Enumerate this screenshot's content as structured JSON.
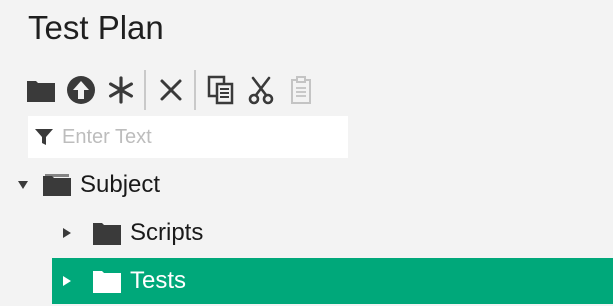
{
  "page": {
    "title": "Test Plan"
  },
  "toolbar": {
    "buttons": [
      {
        "name": "new-folder",
        "icon": "folder-icon"
      },
      {
        "name": "upload",
        "icon": "upload-arrow-icon"
      },
      {
        "name": "new-test",
        "icon": "asterisk-icon"
      },
      {
        "name": "delete",
        "icon": "close-icon"
      },
      {
        "name": "copy",
        "icon": "copy-icon"
      },
      {
        "name": "cut",
        "icon": "scissors-icon",
        "disabled": true
      },
      {
        "name": "paste",
        "icon": "clipboard-icon",
        "disabled": true
      }
    ]
  },
  "filter": {
    "placeholder": "Enter Text",
    "value": ""
  },
  "tree": {
    "root": {
      "label": "Subject",
      "expanded": true
    },
    "children": [
      {
        "label": "Scripts",
        "expanded": false,
        "selected": false
      },
      {
        "label": "Tests",
        "expanded": false,
        "selected": true
      }
    ]
  },
  "colors": {
    "selection": "#00a87a",
    "icon": "#3a3a3a",
    "background": "#f3f3f3"
  }
}
